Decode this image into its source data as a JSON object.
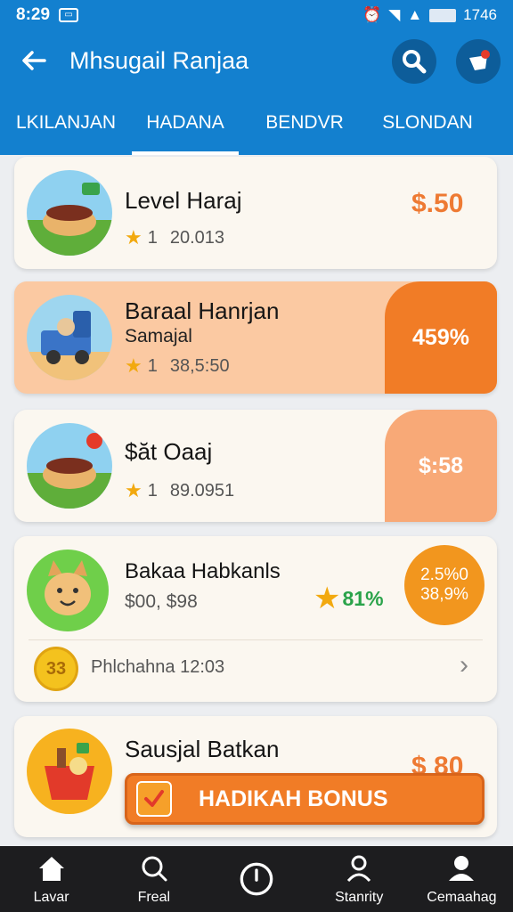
{
  "status_bar": {
    "time": "8:29",
    "right_text": "1746"
  },
  "app_bar": {
    "title": "Mhsugail Ranjaa"
  },
  "tabs": [
    {
      "label": "LKILANJAN"
    },
    {
      "label": "HADANA"
    },
    {
      "label": "BENDVR"
    },
    {
      "label": "SLONDAN"
    }
  ],
  "cards": [
    {
      "title": "Level Haraj",
      "rating": "1",
      "meta": "20.013",
      "price": "$.50"
    },
    {
      "title": "Baraal Hanrjan",
      "subtitle": "Samajal",
      "rating": "1",
      "meta": "38,5:50",
      "price": "459%"
    },
    {
      "title": "$ăt Oaaj",
      "rating": "1",
      "meta": "89.0951",
      "price": "$:58"
    },
    {
      "title": "Bakaa Habkanls",
      "subtitle": "$00, $98",
      "discount": "81%",
      "badge_line1": "2.5%0",
      "badge_line2": "38,9%",
      "coin_label": "33",
      "footer": "Phlchahna 12:03"
    },
    {
      "title": "Sausjal Batkan",
      "price": "$ 80"
    }
  ],
  "bonus_button": {
    "label": "HADIKAH BONUS"
  },
  "bottom_nav": [
    {
      "label": "Lavar",
      "icon": "home-icon"
    },
    {
      "label": "Freal",
      "icon": "search-icon"
    },
    {
      "label": "",
      "icon": "timer-icon"
    },
    {
      "label": "Stanrity",
      "icon": "person-icon"
    },
    {
      "label": "Cemaahag",
      "icon": "profile-icon"
    }
  ],
  "colors": {
    "primary": "#1380cf",
    "accent": "#f17c26",
    "card_bg": "#fbf7f0",
    "nav_bg": "#1d1d1f"
  }
}
